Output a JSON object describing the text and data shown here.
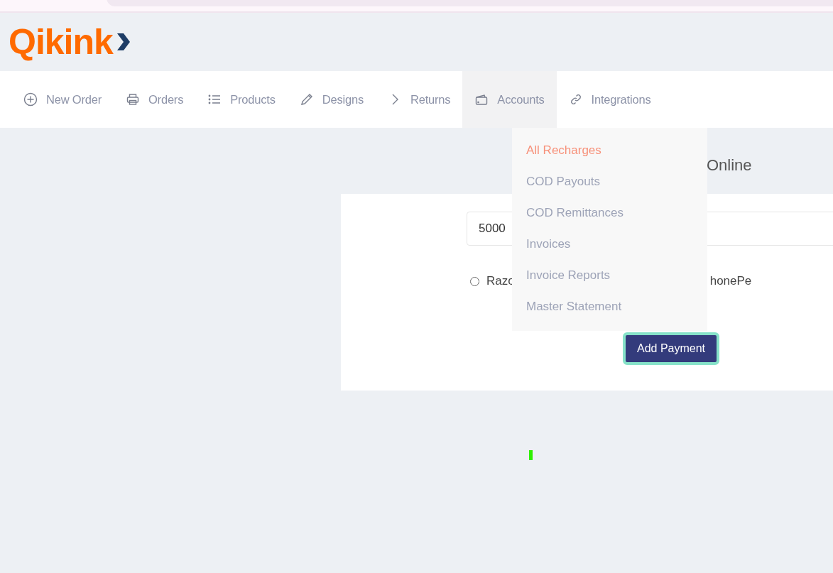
{
  "logo": {
    "text": "Qikink"
  },
  "nav": [
    {
      "label": "New Order",
      "kind": "add",
      "selected": false
    },
    {
      "label": "Orders",
      "kind": "print",
      "selected": false
    },
    {
      "label": "Products",
      "kind": "list",
      "selected": false
    },
    {
      "label": "Designs",
      "kind": "pencil",
      "selected": false
    },
    {
      "label": "Returns",
      "kind": "chevron",
      "selected": false
    },
    {
      "label": "Accounts",
      "kind": "wallet",
      "selected": true
    },
    {
      "label": "Integrations",
      "kind": "link",
      "selected": false
    }
  ],
  "dropdown": [
    {
      "label": "All Recharges",
      "selected": true
    },
    {
      "label": "COD Payouts",
      "selected": false
    },
    {
      "label": "COD Remittances",
      "selected": false
    },
    {
      "label": "Invoices",
      "selected": false
    },
    {
      "label": "Invoice Reports",
      "selected": false
    },
    {
      "label": "Master Statement",
      "selected": false
    }
  ],
  "heading": "Online",
  "amount": {
    "value": "5000"
  },
  "payment_options": [
    {
      "label": "Razo",
      "selected": false
    },
    {
      "label": "honePe"
    }
  ],
  "button": "Add Payment"
}
